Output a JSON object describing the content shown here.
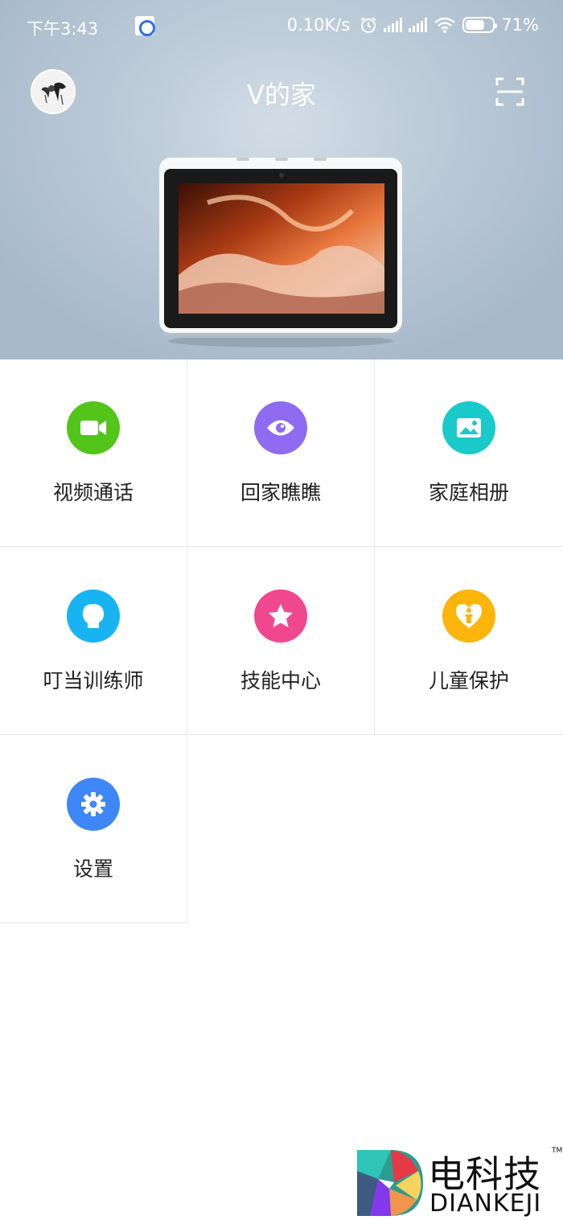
{
  "status_bar": {
    "time": "下午3:43",
    "net_speed": "0.10K/s",
    "battery_percent": "71%",
    "battery_level": 0.71
  },
  "header": {
    "title": "V的家"
  },
  "grid": {
    "items": [
      {
        "label": "视频通话",
        "icon": "video-camera-icon",
        "color": "#52c41a"
      },
      {
        "label": "回家瞧瞧",
        "icon": "eye-icon",
        "color": "#8e6bf1"
      },
      {
        "label": "家庭相册",
        "icon": "photo-album-icon",
        "color": "#1ac9c9"
      },
      {
        "label": "叮当训练师",
        "icon": "head-profile-icon",
        "color": "#18b4f2"
      },
      {
        "label": "技能中心",
        "icon": "star-icon",
        "color": "#f0488f"
      },
      {
        "label": "儿童保护",
        "icon": "child-heart-icon",
        "color": "#fdb50c"
      },
      {
        "label": "设置",
        "icon": "gear-icon",
        "color": "#3f86f7"
      }
    ]
  },
  "watermark": {
    "cn": "电科技",
    "en": "DIANKEJI",
    "tm": "TM"
  }
}
